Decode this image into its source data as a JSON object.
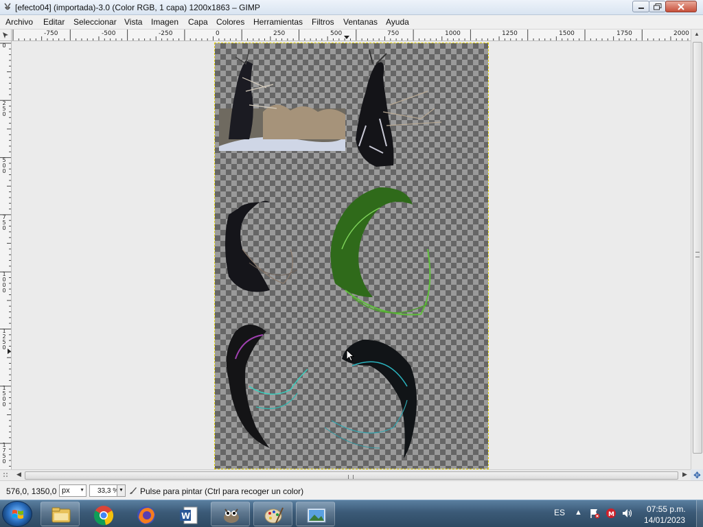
{
  "window": {
    "title": "[efecto04] (importada)-3.0 (Color RGB, 1 capa) 1200x1863 – GIMP",
    "icon": "gimp-wilber-icon"
  },
  "menu": [
    "Archivo",
    "Editar",
    "Seleccionar",
    "Vista",
    "Imagen",
    "Capa",
    "Colores",
    "Herramientas",
    "Filtros",
    "Ventanas",
    "Ayuda"
  ],
  "ruler_h": [
    "-750",
    "-500",
    "-250",
    "0",
    "250",
    "500",
    "750",
    "1000",
    "1250",
    "1500",
    "1750",
    "2000"
  ],
  "ruler_v": [
    "0",
    "250",
    "500",
    "750",
    "1000",
    "1250",
    "1500",
    "1750"
  ],
  "canvas": {
    "background": "checkerboard-transparency",
    "artworks": [
      "photo-tree-snow-scene",
      "tree-cutout",
      "dark-twisted-branch",
      "green-twisted-branch",
      "purple-cyan-twisted-branch",
      "cyan-twisted-branch"
    ]
  },
  "statusbar": {
    "coords": "576,0, 1350,0",
    "unit": "px",
    "zoom": "33,3 %",
    "message": "Pulse para pintar (Ctrl para recoger un color)",
    "tool_icon": "paintbrush-icon"
  },
  "taskbar": {
    "apps": [
      "file-explorer-icon",
      "chrome-icon",
      "firefox-icon",
      "word-icon",
      "gimp-icon",
      "paint-icon",
      "photos-icon"
    ],
    "language": "ES",
    "tray_icons": [
      "show-hidden-icons-arrow",
      "action-center-flag-icon",
      "antivirus-icon",
      "volume-icon"
    ],
    "time": "07:55 p.m.",
    "date": "14/01/2023"
  },
  "colors": {
    "accent": "#e6d400",
    "taskbar": "#3b5a77",
    "checker_dark": "#666666",
    "checker_light": "#9a9a9a"
  }
}
